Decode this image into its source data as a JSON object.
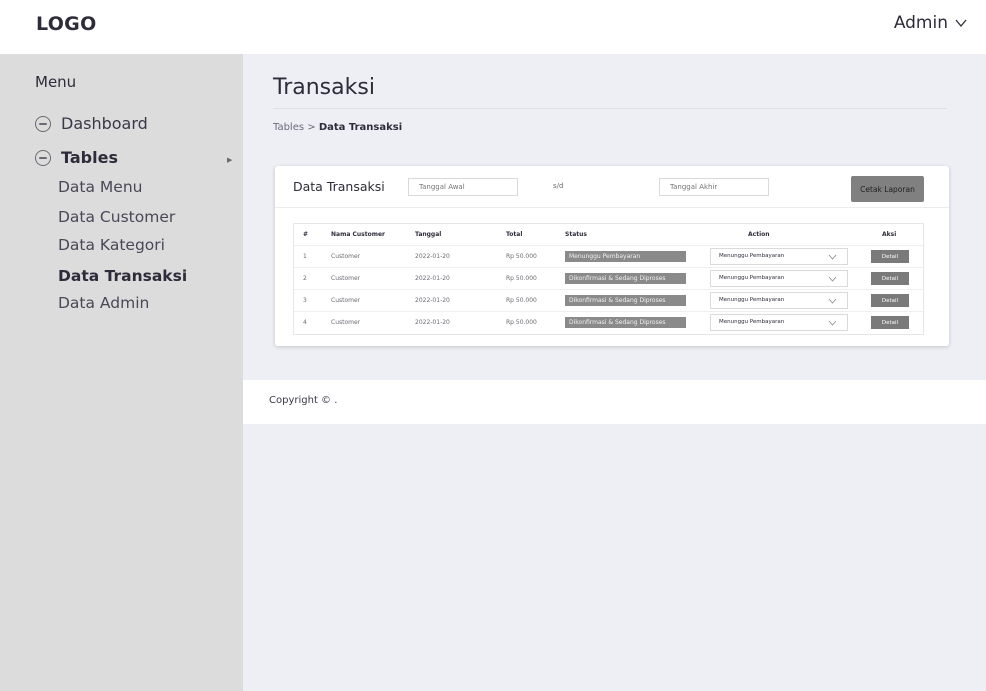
{
  "header": {
    "logo": "LOGO",
    "user_label": "Admin"
  },
  "sidebar": {
    "title": "Menu",
    "dashboard_label": "Dashboard",
    "tables_label": "Tables",
    "sub_items": [
      "Data Menu",
      "Data Customer",
      "Data Kategori",
      "Data Transaksi",
      "Data Admin"
    ],
    "active_sub": "Data Transaksi"
  },
  "page": {
    "title": "Transaksi",
    "breadcrumb_root": "Tables",
    "breadcrumb_sep": " > ",
    "breadcrumb_current": "Data Transaksi"
  },
  "card": {
    "title": "Data Transaksi",
    "start_placeholder": "Tanggal Awal",
    "separator": "s/d",
    "end_placeholder": "Tanggal Akhir",
    "print_label": "Cetak Laporan"
  },
  "table": {
    "headers": [
      "#",
      "Nama Customer",
      "Tanggal",
      "Total",
      "Status",
      "Action",
      "Aksi"
    ],
    "rows": [
      {
        "no": "1",
        "name": "Customer",
        "date": "2022-01-20",
        "total": "Rp 50.000",
        "status": "Menunggu Pembayaran",
        "action": "Menunggu Pembayaran",
        "aksi": "Detail"
      },
      {
        "no": "2",
        "name": "Customer",
        "date": "2022-01-20",
        "total": "Rp 50.000",
        "status": "Dikonfirmasi & Sedang Diproses",
        "action": "Menunggu Pembayaran",
        "aksi": "Detail"
      },
      {
        "no": "3",
        "name": "Customer",
        "date": "2022-01-20",
        "total": "Rp 50.000",
        "status": "Dikonfirmasi & Sedang Diproses",
        "action": "Menunggu Pembayaran",
        "aksi": "Detail"
      },
      {
        "no": "4",
        "name": "Customer",
        "date": "2022-01-20",
        "total": "Rp 50.000",
        "status": "Dikonfirmasi & Sedang Diproses",
        "action": "Menunggu Pembayaran",
        "aksi": "Detail"
      }
    ]
  },
  "footer": {
    "copyright": "Copyright © ."
  },
  "colors": {
    "page_bg": "#eeeff5",
    "sidebar_bg": "#dcdcdc",
    "badge_bg": "#8a8a8a",
    "button_bg": "#7a7a7a",
    "text": "#2e2c3a"
  },
  "icons": {
    "user_menu": "chevron-down-icon",
    "dashboard": "circle-icon",
    "tables": "circle-icon",
    "tables_expand": "caret-right-icon",
    "select": "chevron-down-icon"
  }
}
